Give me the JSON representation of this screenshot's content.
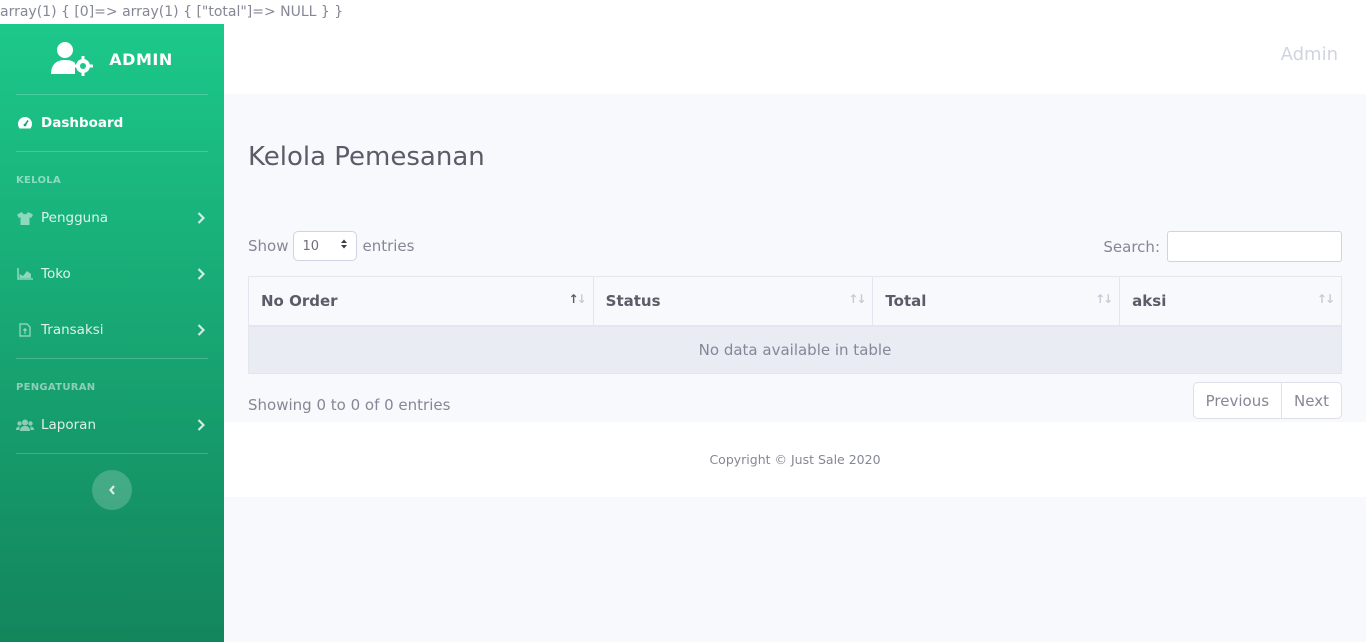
{
  "debug_output": "array(1) { [0]=> array(1) { [\"total\"]=> NULL } }",
  "sidebar": {
    "brand": "ADMIN",
    "dashboard_label": "Dashboard",
    "heading_kelola": "KELOLA",
    "items_kelola": [
      {
        "label": "Pengguna",
        "icon": "tshirt-icon"
      },
      {
        "label": "Toko",
        "icon": "area-chart-icon"
      },
      {
        "label": "Transaksi",
        "icon": "file-invoice-icon"
      }
    ],
    "heading_pengaturan": "PENGATURAN",
    "items_pengaturan": [
      {
        "label": "Laporan",
        "icon": "users-icon"
      }
    ]
  },
  "topbar": {
    "user": "Admin"
  },
  "page": {
    "title": "Kelola Pemesanan"
  },
  "datatable": {
    "show_label": "Show",
    "entries_value": "10",
    "entries_label": "entries",
    "search_label": "Search:",
    "columns": [
      "No Order",
      "Status",
      "Total",
      "aksi"
    ],
    "empty_message": "No data available in table",
    "info": "Showing 0 to 0 of 0 entries",
    "prev": "Previous",
    "next": "Next"
  },
  "footer": {
    "copyright": "Copyright © Just Sale 2020"
  },
  "colors": {
    "sidebar_top": "#1cc88a",
    "sidebar_bottom": "#13855c",
    "text": "#858796"
  }
}
